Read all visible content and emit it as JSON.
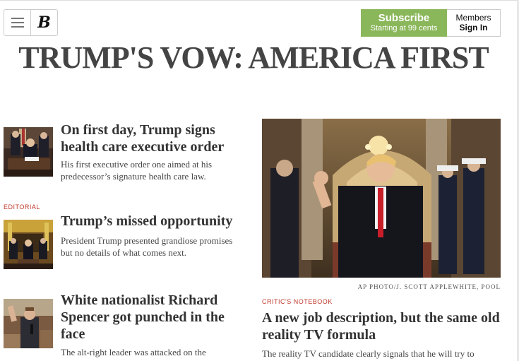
{
  "header": {
    "menu_icon": "hamburger-menu-icon",
    "logo_letter": "B",
    "subscribe_label": "Subscribe",
    "subscribe_sub": "Starting at 99 cents",
    "members_label": "Members",
    "signin_label": "Sign In",
    "subscribe_color": "#8bb75b"
  },
  "main_headline": "TRUMP'S VOW: AMERICA FIRST",
  "left_stories": [
    {
      "kicker": "",
      "title": "On first day, Trump signs health care executive order",
      "desc": "His first executive order one aimed at his predecessor’s signature health care law."
    },
    {
      "kicker": "EDITORIAL",
      "title": "Trump’s missed opportunity",
      "desc": "President Trump presented grandiose promises but no details of what comes next."
    },
    {
      "kicker": "",
      "title": "White nationalist Richard Spencer got punched in the face",
      "desc": "The alt-right leader was attacked on the"
    }
  ],
  "feature": {
    "credit": "AP PHOTO/J. SCOTT APPLEWHITE, POOL",
    "kicker": "CRITIC'S NOTEBOOK",
    "title": "A new job description, but the same old reality TV formula",
    "desc": "The reality TV candidate clearly signals that he will try to"
  }
}
